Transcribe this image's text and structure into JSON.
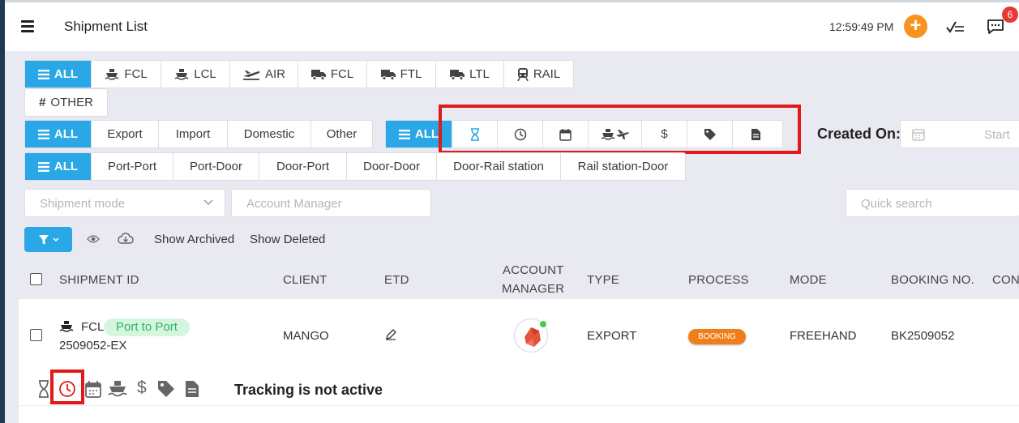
{
  "header": {
    "title": "Shipment List",
    "time": "12:59:49 PM",
    "notification_count": "6"
  },
  "mode_tabs": [
    {
      "label": "ALL",
      "icon": "bars-icon",
      "active": true
    },
    {
      "label": "FCL",
      "icon": "ship-icon"
    },
    {
      "label": "LCL",
      "icon": "ship-icon"
    },
    {
      "label": "AIR",
      "icon": "plane-icon"
    },
    {
      "label": "FCL",
      "icon": "truck-icon"
    },
    {
      "label": "FTL",
      "icon": "truck-icon"
    },
    {
      "label": "LTL",
      "icon": "truck-icon"
    },
    {
      "label": "RAIL",
      "icon": "train-icon"
    },
    {
      "label": "OTHER",
      "icon": "hash-icon"
    }
  ],
  "direction_tabs": [
    "ALL",
    "Export",
    "Import",
    "Domestic",
    "Other"
  ],
  "status_tabs": {
    "all_label": "ALL",
    "icons": [
      "hourglass-icon",
      "clock-icon",
      "calendar-icon",
      "ship-plane-icon",
      "dollar-icon",
      "tag-icon",
      "document-icon"
    ]
  },
  "route_tabs": [
    "ALL",
    "Port-Port",
    "Port-Door",
    "Door-Port",
    "Door-Door",
    "Door-Rail station",
    "Rail station-Door"
  ],
  "created_on": {
    "label": "Created On:",
    "start_placeholder": "Start"
  },
  "filters": {
    "shipment_mode_placeholder": "Shipment mode",
    "account_manager_placeholder": "Account Manager",
    "quick_search_placeholder": "Quick search",
    "show_archived": "Show Archived",
    "show_deleted": "Show Deleted"
  },
  "table": {
    "headers": {
      "shipment_id": "SHIPMENT ID",
      "client": "CLIENT",
      "etd": "ETD",
      "account_manager_1": "ACCOUNT",
      "account_manager_2": "MANAGER",
      "type": "TYPE",
      "process": "PROCESS",
      "mode": "MODE",
      "booking_no": "BOOKING NO.",
      "cont": "CON"
    },
    "rows": [
      {
        "kind": "FCL",
        "route": "Port to Port",
        "id": "2509052-EX",
        "client": "MANGO",
        "type": "EXPORT",
        "process": "BOOKING",
        "mode": "FREEHAND",
        "booking_no": "BK2509052",
        "tracking": "Tracking is not active"
      }
    ]
  },
  "colors": {
    "accent": "#2aa7e6",
    "orange": "#f7931e",
    "badge_red": "#e53935",
    "highlight": "#e01a1a",
    "route_pill_bg": "#d6f5df",
    "route_pill_text": "#2bb565",
    "booking_badge": "#f07f1b"
  }
}
